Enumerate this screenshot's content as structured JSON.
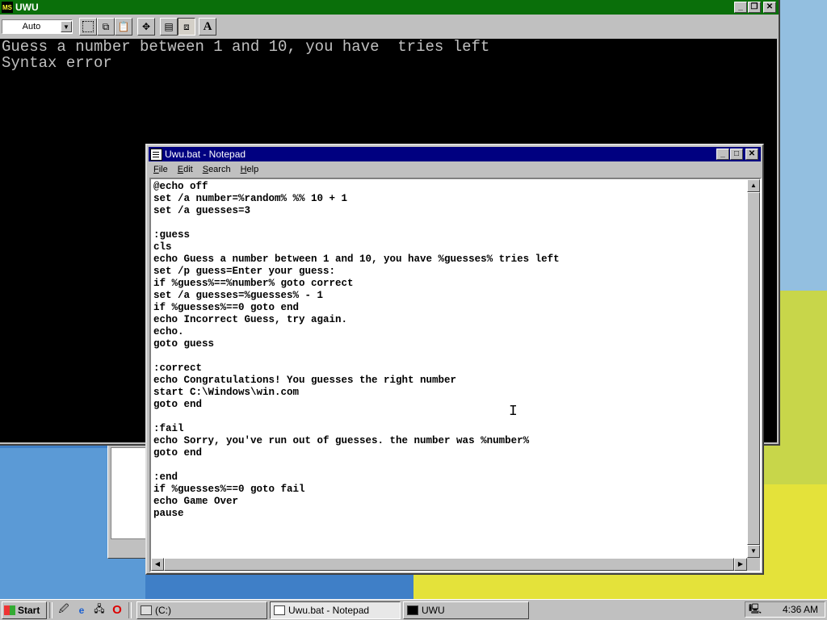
{
  "dos_window": {
    "title": "UWU",
    "toolbar": {
      "font_size": "Auto",
      "font_button_label": "A"
    },
    "output_lines": [
      "Guess a number between 1 and 10, you have  tries left",
      "Syntax error"
    ]
  },
  "notepad": {
    "title": "Uwu.bat - Notepad",
    "menu": [
      {
        "label": "File",
        "hotkey": "F",
        "rest": "ile"
      },
      {
        "label": "Edit",
        "hotkey": "E",
        "rest": "dit"
      },
      {
        "label": "Search",
        "hotkey": "S",
        "rest": "earch"
      },
      {
        "label": "Help",
        "hotkey": "H",
        "rest": "elp"
      }
    ],
    "lines": [
      "@echo off",
      "set /a number=%random% %% 10 + 1",
      "set /a guesses=3",
      "",
      ":guess",
      "cls",
      "echo Guess a number between 1 and 10, you have %guesses% tries left",
      "set /p guess=Enter your guess:",
      "if %guess%==%number% goto correct",
      "set /a guesses=%guesses% - 1",
      "if %guesses%==0 goto end",
      "echo Incorrect Guess, try again.",
      "echo.",
      "goto guess",
      "",
      ":correct",
      "echo Congratulations! You guesses the right number",
      "start C:\\Windows\\win.com",
      "goto end",
      "",
      ":fail",
      "echo Sorry, you've run out of guesses. the number was %number%",
      "goto end",
      "",
      ":end",
      "if %guesses%==0 goto fail",
      "echo Game Over",
      "pause"
    ]
  },
  "taskbar": {
    "start_label": "Start",
    "tasks": [
      {
        "label": "(C:)",
        "active": false
      },
      {
        "label": "Uwu.bat - Notepad",
        "active": true
      },
      {
        "label": "UWU",
        "active": false
      }
    ],
    "clock": "4:36 AM"
  }
}
